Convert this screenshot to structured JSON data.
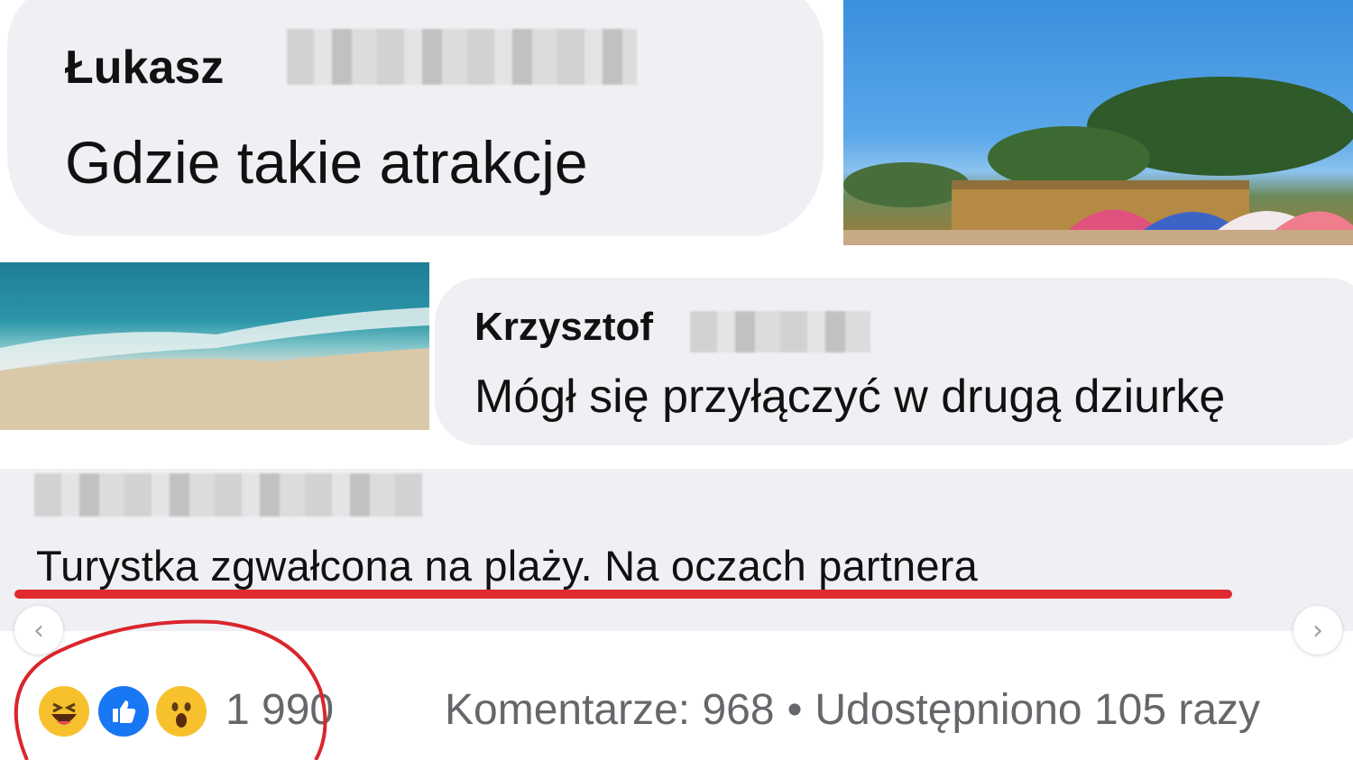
{
  "comments": [
    {
      "author": "Łukasz",
      "text": "Gdzie takie atrakcje"
    },
    {
      "author": "Krzysztof",
      "text": "Mógł się przyłączyć w drugą dziurkę"
    }
  ],
  "post": {
    "headline": "Turystka zgwałcona na plaży. Na oczach partnera"
  },
  "navigation": {
    "prev_icon": "chevron-left-icon",
    "next_icon": "chevron-right-icon",
    "prev_glyph": "‹",
    "next_glyph": "›"
  },
  "reactions": {
    "icons": [
      "haha-reaction-icon",
      "like-reaction-icon",
      "wow-reaction-icon"
    ],
    "count": "1 990"
  },
  "stats": {
    "comments": "Komentarze: 968",
    "separator": "•",
    "shares": "Udostępniono 105 razy"
  },
  "colors": {
    "underline": "#e12a2f",
    "like_blue": "#1877f2",
    "emoji_yellow": "#f7c12e",
    "muted_text": "#65676b",
    "bubble_bg": "#eff0f3"
  }
}
